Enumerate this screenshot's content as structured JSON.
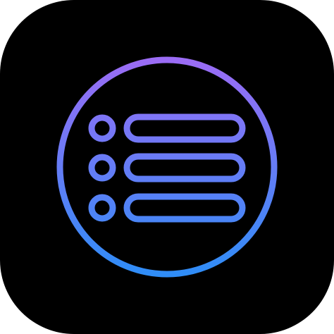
{
  "icon": {
    "name": "list-icon",
    "background_color": "#000000",
    "gradient": {
      "top_color": "#9b6cf5",
      "bottom_color": "#2f8df7"
    },
    "rows": [
      {
        "name": "row-1"
      },
      {
        "name": "row-2"
      },
      {
        "name": "row-3"
      }
    ]
  }
}
